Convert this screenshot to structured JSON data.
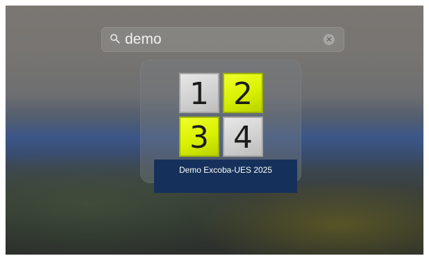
{
  "spotlight": {
    "search": {
      "value": "demo",
      "search_icon": "search-icon",
      "clear_icon": "clear-icon",
      "clear_glyph": "✕"
    },
    "result": {
      "app_name": "Demo Excoba-UES 2025",
      "icon_tiles": [
        {
          "number": "1",
          "color": "#d0d0d0"
        },
        {
          "number": "2",
          "color": "#d8f000"
        },
        {
          "number": "3",
          "color": "#d8f000"
        },
        {
          "number": "4",
          "color": "#d0d0d0"
        }
      ]
    }
  }
}
